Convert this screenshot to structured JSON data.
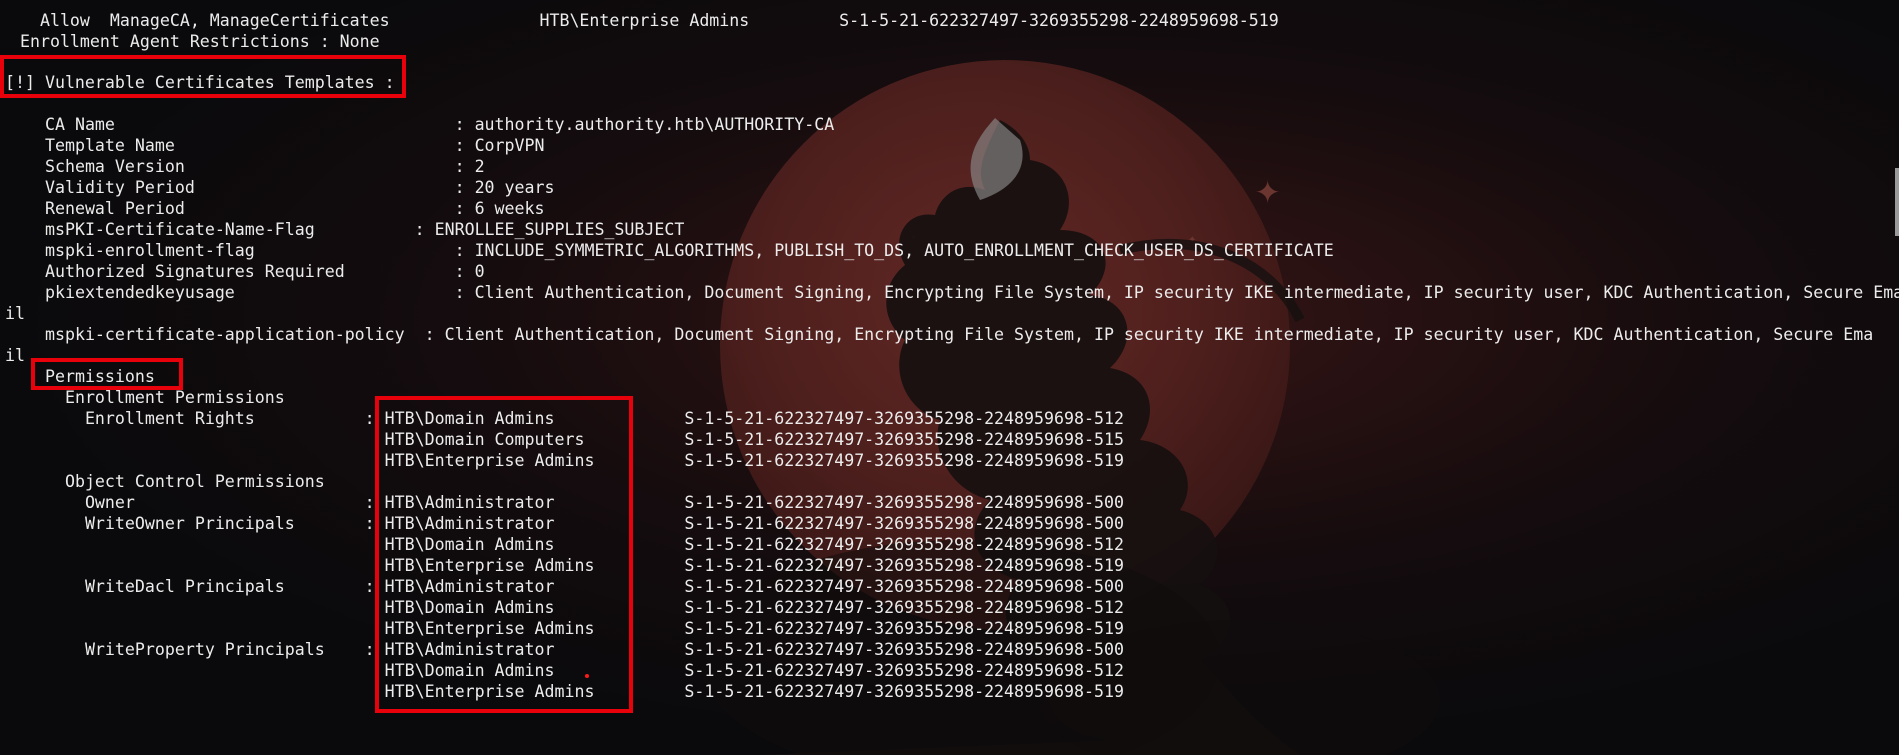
{
  "terminal": {
    "lines": [
      "    Allow  ManageCA, ManageCertificates               HTB\\Enterprise Admins         S-1-5-21-622327497-3269355298-2248959698-519",
      "  Enrollment Agent Restrictions : None",
      "",
      "[!] Vulnerable Certificates Templates :",
      "",
      "  CA Name                                  : authority.authority.htb\\AUTHORITY-CA",
      "  Template Name                            : CorpVPN",
      "  Schema Version                           : 2",
      "  Validity Period                          : 20 years",
      "  Renewal Period                           : 6 weeks",
      "  msPKI-Certificate-Name-Flag          : ENROLLEE_SUPPLIES_SUBJECT",
      "  mspki-enrollment-flag                    : INCLUDE_SYMMETRIC_ALGORITHMS, PUBLISH_TO_DS, AUTO_ENROLLMENT_CHECK_USER_DS_CERTIFICATE",
      "  Authorized Signatures Required           : 0",
      "  pkiextendedkeyusage                      : Client Authentication, Document Signing, Encrypting File System, IP security IKE intermediate, IP security user, KDC Authentication, Secure Ema",
      "il",
      "  mspki-certificate-application-policy  : Client Authentication, Document Signing, Encrypting File System, IP security IKE intermediate, IP security user, KDC Authentication, Secure Ema",
      "il",
      "  Permissions",
      "    Enrollment Permissions",
      "      Enrollment Rights           : HTB\\Domain Admins             S-1-5-21-622327497-3269355298-2248959698-512",
      "                                    HTB\\Domain Computers          S-1-5-21-622327497-3269355298-2248959698-515",
      "                                    HTB\\Enterprise Admins         S-1-5-21-622327497-3269355298-2248959698-519",
      "",
      "    Object Control Permissions",
      "      Owner                       : HTB\\Administrator             S-1-5-21-622327497-3269355298-2248959698-500",
      "      WriteOwner Principals       : HTB\\Administrator             S-1-5-21-622327497-3269355298-2248959698-500",
      "                                    HTB\\Domain Admins             S-1-5-21-622327497-3269355298-2248959698-512",
      "                                    HTB\\Enterprise Admins         S-1-5-21-622327497-3269355298-2248959698-519",
      "      WriteDacl Principals        : HTB\\Administrator             S-1-5-21-622327497-3269355298-2248959698-500",
      "                                    HTB\\Domain Admins             S-1-5-21-622327497-3269355298-2248959698-512",
      "                                    HTB\\Enterprise Admins         S-1-5-21-622327497-3269355298-2248959698-519",
      "      WriteProperty Principals    : HTB\\Administrator             S-1-5-21-622327497-3269355298-2248959698-500",
      "                                    HTB\\Domain Admins             S-1-5-21-622327497-3269355298-2248959698-512",
      "                                    HTB\\Enterprise Admins         S-1-5-21-622327497-3269355298-2248959698-519"
    ]
  },
  "colors": {
    "terminal_text": "#ececec",
    "highlight_box": "#e8000b",
    "background": "#0b0b0d",
    "moon": "#55221f"
  },
  "wallpaper": {
    "icon": "dragon-moon-wallpaper"
  }
}
